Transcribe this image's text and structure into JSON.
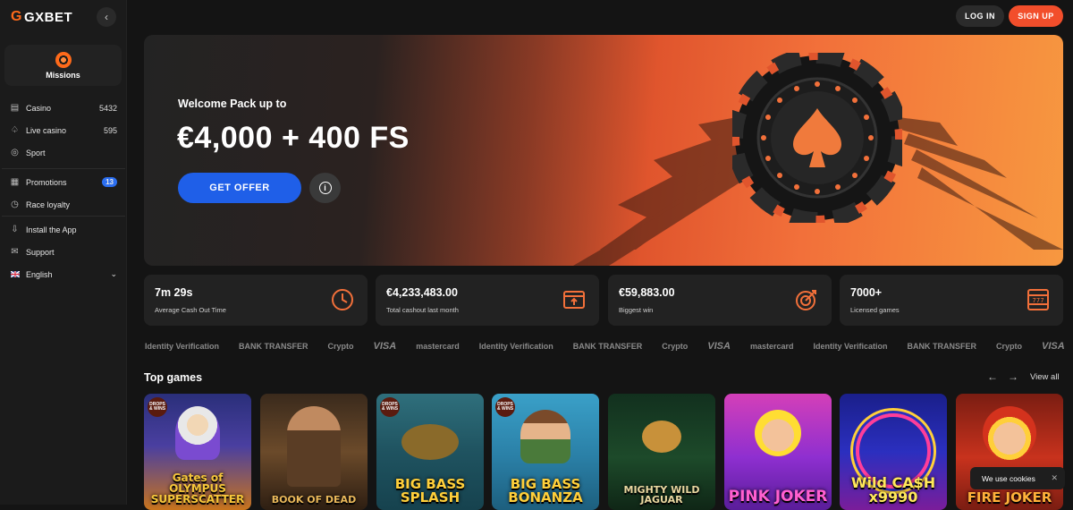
{
  "brand": {
    "name": "GXBET",
    "accent": "#f24e2b"
  },
  "sidebar": {
    "missions": "Missions",
    "group1": [
      {
        "label": "Casino",
        "count": "5432",
        "icon": "casino-icon"
      },
      {
        "label": "Live casino",
        "count": "595",
        "icon": "live-casino-icon"
      },
      {
        "label": "Sport",
        "count": "",
        "icon": "sport-icon"
      }
    ],
    "group2": [
      {
        "label": "Promotions",
        "badge": "13",
        "icon": "gift-icon"
      },
      {
        "label": "Race loyalty",
        "icon": "race-icon"
      }
    ],
    "group3": [
      {
        "label": "Install the App",
        "icon": "install-icon"
      },
      {
        "label": "Support",
        "icon": "support-icon"
      },
      {
        "label": "English",
        "icon": "flag-uk-icon"
      }
    ]
  },
  "header": {
    "login": "LOG IN",
    "signup": "SIGN UP"
  },
  "hero": {
    "subtitle": "Welcome Pack up to",
    "title": "€4,000 + 400 FS",
    "cta": "GET OFFER"
  },
  "stats": [
    {
      "value": "7m 29s",
      "label": "Average Cash Out Time",
      "icon": "clock-icon"
    },
    {
      "value": "€4,233,483.00",
      "label": "Total cashout last month",
      "icon": "cashout-icon"
    },
    {
      "value": "€59,883.00",
      "label": "Biggest win",
      "icon": "target-icon"
    },
    {
      "value": "7000+",
      "label": "Licensed games",
      "icon": "slot-machine-icon"
    }
  ],
  "payments": [
    "Identity Verification",
    "BANK TRANSFER",
    "Crypto",
    "VISA",
    "mastercard",
    "Identity Verification",
    "BANK TRANSFER",
    "Crypto",
    "VISA",
    "mastercard",
    "Identity Verification",
    "BANK TRANSFER",
    "Crypto",
    "VISA"
  ],
  "top_games": {
    "title": "Top games",
    "view_all": "View all",
    "games": [
      {
        "name": "Gates of Olympus Super Scatter",
        "art_text": "Gates of OLYMPUS SUPERSCATTER",
        "badge": "DROPS & WINS"
      },
      {
        "name": "Book of Dead",
        "art_text": "BOOK OF DEAD",
        "badge": ""
      },
      {
        "name": "Big Bass Splash",
        "art_text": "BIG BASS SPLASH",
        "badge": "DROPS & WINS"
      },
      {
        "name": "Big Bass Bonanza",
        "art_text": "BIG BASS BONANZA",
        "badge": "DROPS & WINS"
      },
      {
        "name": "Mighty Wild Jaguar",
        "art_text": "MIGHTY WILD JAGUAR",
        "badge": ""
      },
      {
        "name": "Pink Joker",
        "art_text": "PINK JOKER",
        "badge": ""
      },
      {
        "name": "Wild Cash x9990",
        "art_text": "Wild CA$H x9990",
        "badge": ""
      },
      {
        "name": "Fire Joker",
        "art_text": "FIRE JOKER",
        "badge": ""
      }
    ]
  },
  "cookies": {
    "text": "We use cookies"
  }
}
